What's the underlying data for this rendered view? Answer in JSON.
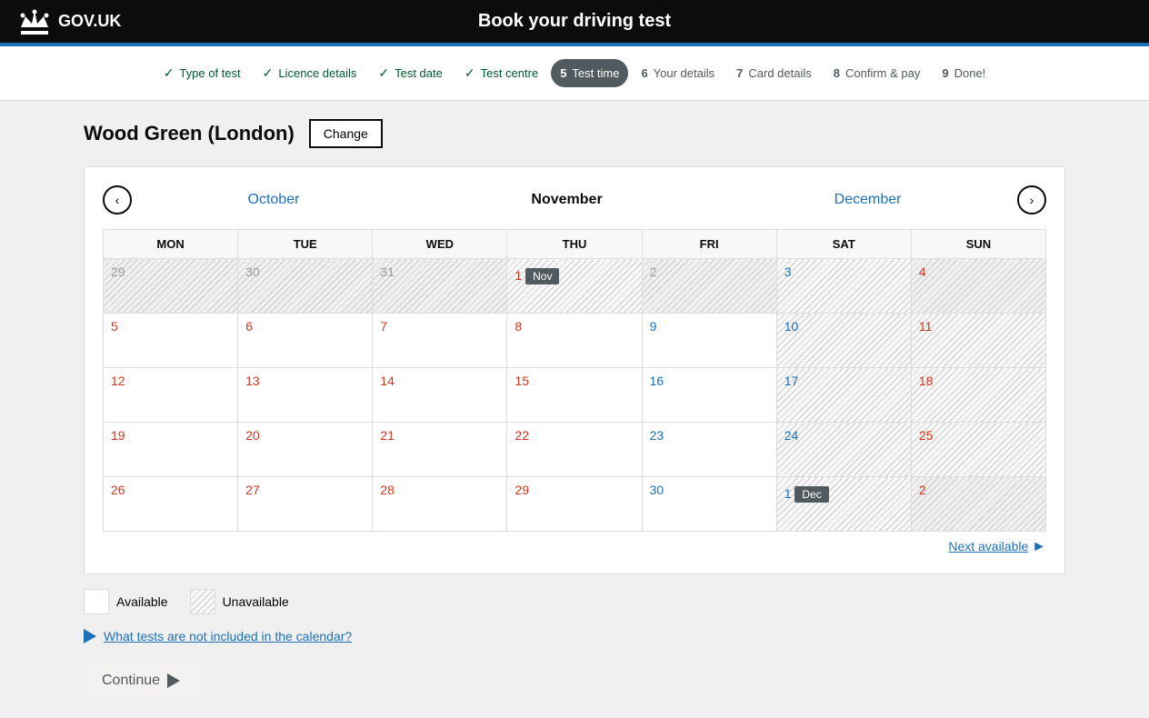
{
  "header": {
    "logo_text": "GOV.UK",
    "title": "Book your driving test"
  },
  "progress": {
    "steps": [
      {
        "id": "type-of-test",
        "num": "",
        "label": "Type of test",
        "state": "completed"
      },
      {
        "id": "licence-details",
        "num": "",
        "label": "Licence details",
        "state": "completed"
      },
      {
        "id": "test-date",
        "num": "",
        "label": "Test date",
        "state": "completed"
      },
      {
        "id": "test-centre",
        "num": "",
        "label": "Test centre",
        "state": "completed"
      },
      {
        "id": "test-time",
        "num": "5",
        "label": "Test time",
        "state": "active"
      },
      {
        "id": "your-details",
        "num": "6",
        "label": "Your details",
        "state": "inactive"
      },
      {
        "id": "card-details",
        "num": "7",
        "label": "Card details",
        "state": "inactive"
      },
      {
        "id": "confirm-pay",
        "num": "8",
        "label": "Confirm & pay",
        "state": "inactive"
      },
      {
        "id": "done",
        "num": "9",
        "label": "Done!",
        "state": "inactive"
      }
    ]
  },
  "location": {
    "name": "Wood Green (London)",
    "change_label": "Change"
  },
  "calendar": {
    "prev_month": "October",
    "current_month": "November",
    "next_month": "December",
    "days_of_week": [
      "MON",
      "TUE",
      "WED",
      "THU",
      "FRI",
      "SAT",
      "SUN"
    ],
    "rows": [
      {
        "cells": [
          {
            "day": "29",
            "type": "outside",
            "dow": "mon"
          },
          {
            "day": "30",
            "type": "outside",
            "dow": "tue"
          },
          {
            "day": "31",
            "type": "outside",
            "dow": "wed"
          },
          {
            "day": "1",
            "type": "unavailable",
            "dow": "thu",
            "badge": "Nov"
          },
          {
            "day": "2",
            "type": "outside",
            "dow": "fri"
          },
          {
            "day": "3",
            "type": "unavailable",
            "dow": "sat"
          },
          {
            "day": "4",
            "type": "outside",
            "dow": "sun"
          }
        ]
      },
      {
        "cells": [
          {
            "day": "5",
            "type": "available",
            "dow": "mon"
          },
          {
            "day": "6",
            "type": "available",
            "dow": "tue"
          },
          {
            "day": "7",
            "type": "available",
            "dow": "wed"
          },
          {
            "day": "8",
            "type": "available",
            "dow": "thu"
          },
          {
            "day": "9",
            "type": "available",
            "dow": "fri"
          },
          {
            "day": "10",
            "type": "unavailable",
            "dow": "sat"
          },
          {
            "day": "11",
            "type": "unavailable",
            "dow": "sun"
          }
        ]
      },
      {
        "cells": [
          {
            "day": "12",
            "type": "available",
            "dow": "mon"
          },
          {
            "day": "13",
            "type": "available",
            "dow": "tue"
          },
          {
            "day": "14",
            "type": "available",
            "dow": "wed"
          },
          {
            "day": "15",
            "type": "available",
            "dow": "thu"
          },
          {
            "day": "16",
            "type": "available",
            "dow": "fri"
          },
          {
            "day": "17",
            "type": "unavailable",
            "dow": "sat"
          },
          {
            "day": "18",
            "type": "unavailable",
            "dow": "sun"
          }
        ]
      },
      {
        "cells": [
          {
            "day": "19",
            "type": "available",
            "dow": "mon"
          },
          {
            "day": "20",
            "type": "available",
            "dow": "tue"
          },
          {
            "day": "21",
            "type": "available",
            "dow": "wed"
          },
          {
            "day": "22",
            "type": "available",
            "dow": "thu"
          },
          {
            "day": "23",
            "type": "available",
            "dow": "fri"
          },
          {
            "day": "24",
            "type": "unavailable",
            "dow": "sat"
          },
          {
            "day": "25",
            "type": "unavailable",
            "dow": "sun"
          }
        ]
      },
      {
        "cells": [
          {
            "day": "26",
            "type": "available",
            "dow": "mon"
          },
          {
            "day": "27",
            "type": "available",
            "dow": "tue"
          },
          {
            "day": "28",
            "type": "available",
            "dow": "wed"
          },
          {
            "day": "29",
            "type": "available",
            "dow": "thu"
          },
          {
            "day": "30",
            "type": "available",
            "dow": "fri"
          },
          {
            "day": "1",
            "type": "unavailable",
            "dow": "sat",
            "badge": "Dec"
          },
          {
            "day": "2",
            "type": "outside",
            "dow": "sun"
          }
        ]
      }
    ],
    "next_available_label": "Next available"
  },
  "legend": {
    "available_label": "Available",
    "unavailable_label": "Unavailable"
  },
  "info_link": {
    "text": "What tests are not included in the calendar?"
  },
  "continue_button": {
    "label": "Continue"
  }
}
